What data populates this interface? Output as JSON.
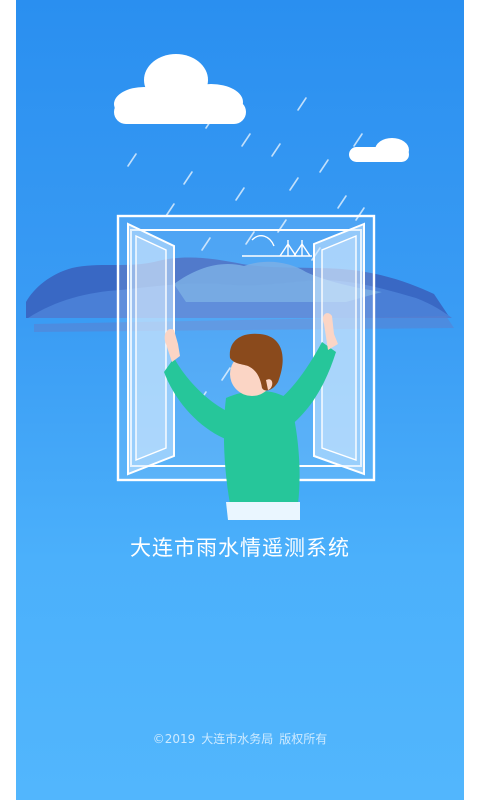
{
  "app": {
    "title": "大连市雨水情遥测系统",
    "copyright": "©2019",
    "organization": "大连市水务局",
    "rights": "版权所有"
  },
  "illustration": {
    "icons": [
      "cloud-icon",
      "cloud-icon",
      "rain-icon",
      "mountain-icon",
      "bridge-icon",
      "window-icon",
      "person-icon"
    ]
  },
  "colors": {
    "background_top": "#2a8ff0",
    "background_bottom": "#52b6fd",
    "sweater": "#26c69a",
    "hair": "#8a4a1c",
    "text": "#ffffff"
  }
}
